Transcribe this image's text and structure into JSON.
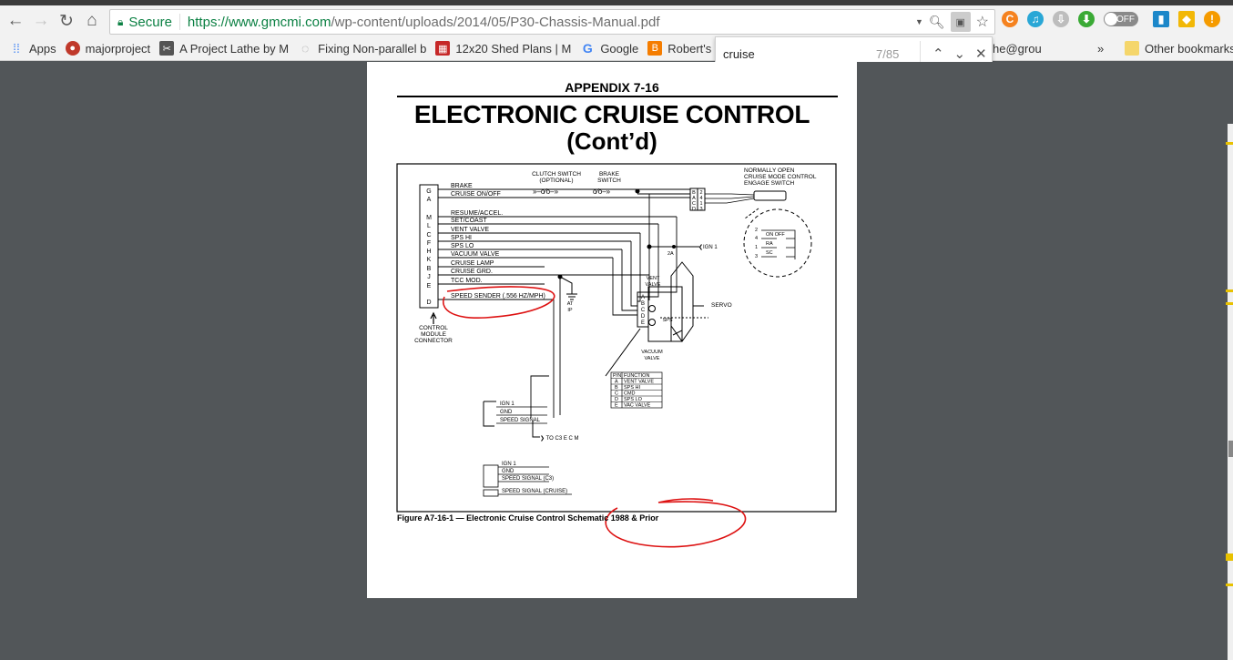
{
  "browser": {
    "nav": {
      "back": "←",
      "forward": "→",
      "reload": "↻",
      "home": "⌂"
    },
    "security_label": "Secure",
    "url_host": "https://www.gmcmi.com",
    "url_path": "/wp-content/uploads/2014/05/P30-Chassis-Manual.pdf",
    "omnibox_icons": [
      "dropdown-icon",
      "zoom-icon",
      "pdf-search-icon",
      "star-icon"
    ],
    "extensions": [
      {
        "name": "orange-ext",
        "glyph": "C",
        "color": "#f5821f"
      },
      {
        "name": "headphones-ext",
        "glyph": "♫",
        "color": "#29a7d6"
      },
      {
        "name": "download-ext",
        "glyph": "⇩",
        "color": "#9e9e9e"
      },
      {
        "name": "green-download-ext",
        "glyph": "⬇",
        "color": "#3aaa35"
      },
      {
        "name": "toggle-off",
        "label": "OFF"
      },
      {
        "name": "blue-ext",
        "glyph": "▮",
        "color": "#1c87c9"
      },
      {
        "name": "yellow-ext",
        "glyph": "◆",
        "color": "#f2b807"
      },
      {
        "name": "alert-ext",
        "glyph": "!",
        "color": "#f59b00"
      }
    ]
  },
  "bookmarks": [
    {
      "label": "Apps",
      "icon": "apps-icon",
      "color": "#4285f4"
    },
    {
      "label": "majorproject",
      "icon": "red-circle-icon",
      "color": "#c0392b"
    },
    {
      "label": "A Project Lathe by M",
      "icon": "lathe-icon",
      "color": "#555"
    },
    {
      "label": "Fixing Non-parallel b",
      "icon": "ring-icon",
      "color": "#999"
    },
    {
      "label": "12x20 Shed Plans | M",
      "icon": "shed-icon",
      "color": "#c62828"
    },
    {
      "label": "Google",
      "icon": "google-icon",
      "color": "#4285f4"
    },
    {
      "label": "Robert's Pro",
      "icon": "blogger-icon",
      "color": "#f57d00"
    }
  ],
  "bookmarks_right": {
    "partial": "he@grou",
    "overflow": "»",
    "other": "Other bookmarks"
  },
  "find": {
    "query": "cruise",
    "count": "7/85",
    "prev": "⌃",
    "next": "⌄",
    "close": "✕"
  },
  "document": {
    "appendix": "APPENDIX 7-16",
    "title_line1": "ELECTRONIC CRUISE CONTROL",
    "title_line2": "(Cont’d)",
    "connector_pins": [
      "G",
      "A",
      "M",
      "L",
      "C",
      "F",
      "H",
      "K",
      "B",
      "J",
      "E",
      "D"
    ],
    "wire_labels": [
      "BRAKE",
      "CRUISE ON/OFF",
      "RESUME/ACCEL.",
      "SET/COAST",
      "VENT VALVE",
      "SPS HI",
      "SPS LO",
      "VACUUM VALVE",
      "CRUISE LAMP",
      "CRUISE GRD.",
      "TCC MOD.",
      "SPEED SENDER (.556 HZ/MPH)"
    ],
    "connector_label": [
      "CONTROL",
      "MODULE",
      "CONNECTOR"
    ],
    "clutch_switch": [
      "CLUTCH SWITCH",
      "(OPTIONAL)"
    ],
    "brake_switch": [
      "BRAKE",
      "SWITCH"
    ],
    "engage_switch": [
      "NORMALLY OPEN",
      "CRUISE MODE CONTROL",
      "ENGAGE SWITCH"
    ],
    "switch_block_left": [
      "B",
      "A",
      "C",
      "D"
    ],
    "switch_block_right": [
      "2",
      "4",
      "1",
      "3"
    ],
    "detail_pins": [
      "2",
      "4",
      "1",
      "3"
    ],
    "detail_labels": [
      "ON OFF",
      "RA",
      "SC"
    ],
    "ign_label": "IGN 1",
    "fuse_label": "2A",
    "ground_label": [
      "AT",
      "IP"
    ],
    "vent_valve": [
      "VENT",
      "VALVE"
    ],
    "vacuum_valve": [
      "VACUUM",
      "VALVE"
    ],
    "sps": "SPS",
    "servo": "SERVO",
    "servo_pins": [
      "A",
      "B",
      "C",
      "D",
      "E"
    ],
    "pin_table": {
      "headers": [
        "P/N",
        "FUNCTION"
      ],
      "rows": [
        [
          "A",
          "VENT VALVE"
        ],
        [
          "B",
          "SPS HI"
        ],
        [
          "C",
          "CMD"
        ],
        [
          "D",
          "SPS LO"
        ],
        [
          "E",
          "VAC VALVE"
        ]
      ]
    },
    "conn1": [
      "IGN 1",
      "GND",
      "SPEED SIGNAL"
    ],
    "to_ecm": "TO C3 E C M",
    "conn2": [
      "IGN 1",
      "GND",
      "SPEED SIGNAL (C3)",
      "SPEED SIGNAL (CRUISE)"
    ],
    "caption": "Figure A7-16-1 — Electronic Cruise Control Schematic 1988 & Prior"
  }
}
